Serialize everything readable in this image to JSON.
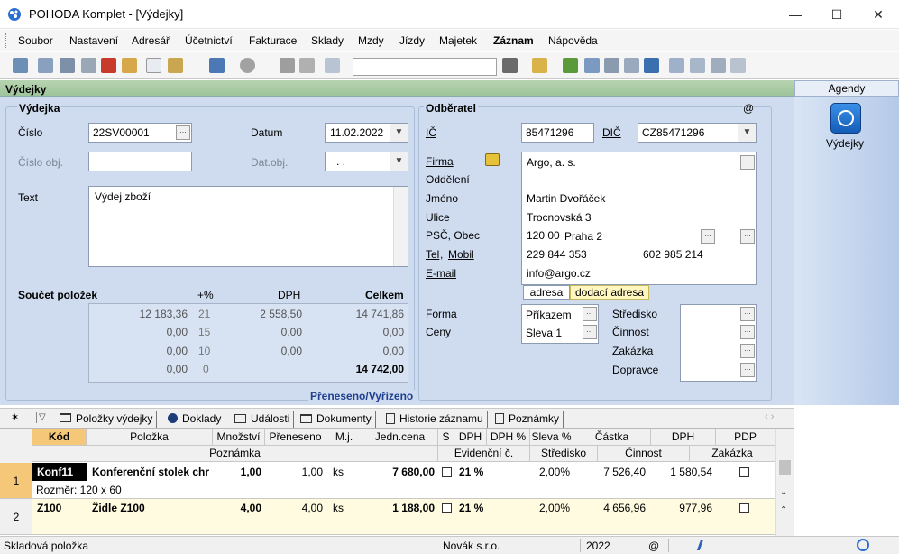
{
  "window": {
    "title": "POHODA Komplet - [Výdejky]",
    "minimize": "—",
    "maximize": "☐",
    "close": "✕"
  },
  "menu": [
    "Soubor",
    "Nastavení",
    "Adresář",
    "Účetnictví",
    "Fakturace",
    "Sklady",
    "Mzdy",
    "Jízdy",
    "Majetek",
    "Záznam",
    "Nápověda"
  ],
  "form": {
    "section_title": "Výdejky",
    "vydejka": {
      "group_title": "Výdejka",
      "cislo_label": "Číslo",
      "cislo_value": "22SV00001",
      "datum_label": "Datum",
      "datum_value": "11.02.2022",
      "cislo_obj_label": "Číslo obj.",
      "dat_obj_label": "Dat.obj.",
      "dat_obj_value": ". .",
      "text_label": "Text",
      "text_value": "Výdej zboží"
    },
    "soucet": {
      "title": "Součet položek",
      "col_pct": "+%",
      "col_dph": "DPH",
      "col_celkem": "Celkem",
      "rows": [
        [
          "12 183,36",
          "21",
          "2 558,50",
          "14 741,86"
        ],
        [
          "0,00",
          "15",
          "0,00",
          "0,00"
        ],
        [
          "0,00",
          "10",
          "0,00",
          "0,00"
        ],
        [
          "0,00",
          "0",
          "",
          "14 742,00"
        ]
      ]
    },
    "preneseno": "Přeneseno/Vyřízeno",
    "odberatel": {
      "group_title": "Odběratel",
      "at_sign": "@",
      "ic_label": "IČ",
      "ic_value": "85471296",
      "dic_label": "DIČ",
      "dic_value": "CZ85471296",
      "firma_label": "Firma",
      "oddeleni_label": "Oddělení",
      "jmeno_label": "Jméno",
      "ulice_label": "Ulice",
      "psc_label": "PSČ, Obec",
      "tel_label": "Tel",
      "mobil_label": "Mobil",
      "email_label": "E-mail",
      "firma_value": "Argo, a. s.",
      "jmeno_value": "Martin Dvořáček",
      "ulice_value": "Trocnovská 3",
      "psc_value": "120 00",
      "obec_value": "Praha 2",
      "tel_value": "229 844 353",
      "mobil_value": "602 985 214",
      "email_value": "info@argo.cz",
      "tab_adresa": "adresa",
      "tab_dodaci": "dodací adresa"
    },
    "forma_label": "Forma",
    "forma_value": "Příkazem",
    "ceny_label": "Ceny",
    "ceny_value": "Sleva 1",
    "stredisko_label": "Středisko",
    "cinnost_label": "Činnost",
    "zakazka_label": "Zakázka",
    "dopravce_label": "Dopravce"
  },
  "agendy": {
    "header": "Agendy",
    "item": "Výdejky"
  },
  "tabs": [
    "Položky výdejky",
    "Doklady",
    "Události",
    "Dokumenty",
    "Historie záznamu",
    "Poznámky"
  ],
  "grid": {
    "head1": [
      "Kód",
      "Položka",
      "Množství",
      "Přeneseno",
      "M.j.",
      "Jedn.cena",
      "S",
      "DPH",
      "DPH %",
      "Sleva %",
      "Částka",
      "DPH",
      "PDP"
    ],
    "head2": [
      "Poznámka",
      "Evidenční č.",
      "Středisko",
      "Činnost",
      "Zakázka"
    ],
    "rows": [
      {
        "num": "1",
        "kod": "Konf11",
        "polozka": "Konferenční stolek chr",
        "mnozstvi": "1,00",
        "preneseno": "1,00",
        "mj": "ks",
        "cena": "7 680,00",
        "dph": "21 %",
        "sleva": "2,00%",
        "castka": "7 526,40",
        "dph_val": "1 580,54",
        "note": "Rozměr: 120 x 60"
      },
      {
        "num": "2",
        "kod": "Z100",
        "polozka": "Židle Z100",
        "mnozstvi": "4,00",
        "preneseno": "4,00",
        "mj": "ks",
        "cena": "1 188,00",
        "dph": "21 %",
        "sleva": "2,00%",
        "castka": "4 656,96",
        "dph_val": "977,96",
        "note": ""
      }
    ]
  },
  "status": {
    "left": "Skladová položka",
    "firm": "Novák s.r.o.",
    "year": "2022",
    "at": "@"
  }
}
